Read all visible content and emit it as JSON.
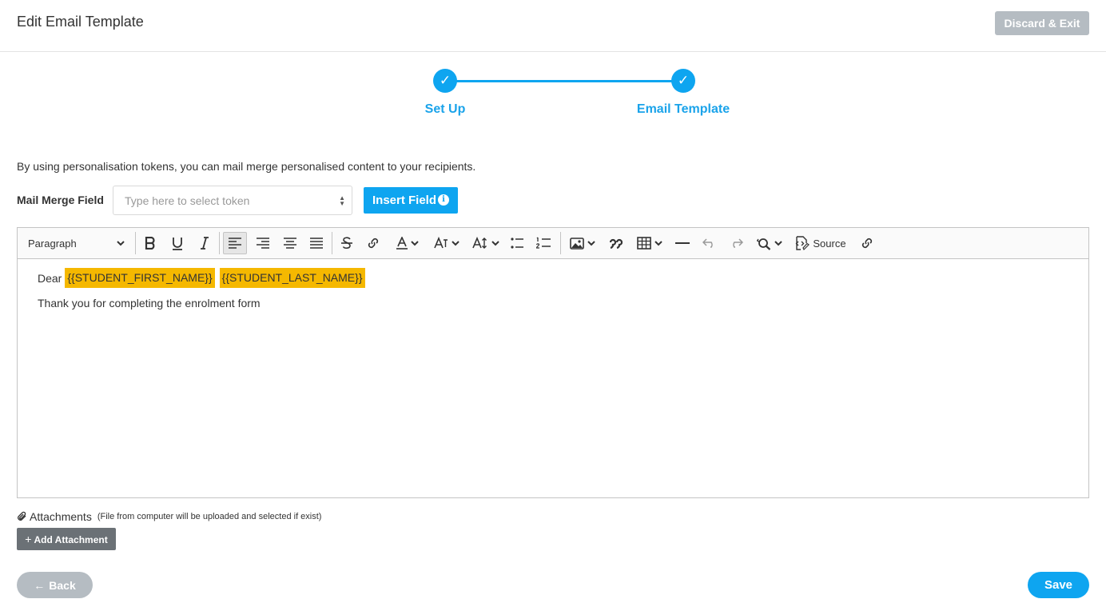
{
  "header": {
    "title": "Edit Email Template",
    "discard_label": "Discard & Exit"
  },
  "stepper": {
    "steps": [
      {
        "label": "Set Up",
        "check": "✓"
      },
      {
        "label": "Email Template",
        "check": "✓"
      }
    ]
  },
  "intro_text": "By using personalisation tokens, you can mail merge personalised content to your recipients.",
  "mail_merge": {
    "label": "Mail Merge Field",
    "placeholder": "Type here to select token",
    "value": "",
    "insert_label": "Insert Field",
    "info_glyph": "i"
  },
  "toolbar": {
    "paragraph_label": "Paragraph",
    "source_label": "Source",
    "icons": [
      "bold-icon",
      "underline-icon",
      "italic-icon",
      "align-left-icon",
      "align-right-icon",
      "align-center-icon",
      "align-justify-icon",
      "strikethrough-icon",
      "link-icon",
      "font-color-icon",
      "font-family-icon",
      "font-size-icon",
      "bulleted-list-icon",
      "numbered-list-icon",
      "image-icon",
      "block-quote-icon",
      "table-icon",
      "horizontal-line-icon",
      "undo-icon",
      "redo-icon",
      "find-replace-icon",
      "source-icon",
      "unlink-icon"
    ]
  },
  "editor": {
    "greeting": "Dear",
    "tokens": [
      "{{STUDENT_FIRST_NAME}}",
      "{{STUDENT_LAST_NAME}}"
    ],
    "body_line": "Thank you for completing the enrolment form",
    "token_color": "#f5b800"
  },
  "attachments": {
    "title": "Attachments",
    "note": "(File from computer will be uploaded and selected if exist)",
    "add_label": "Add Attachment"
  },
  "footer": {
    "back_label": "Back",
    "save_label": "Save"
  },
  "colors": {
    "accent": "#0ea5f0",
    "disabled": "#b5bcc2"
  }
}
